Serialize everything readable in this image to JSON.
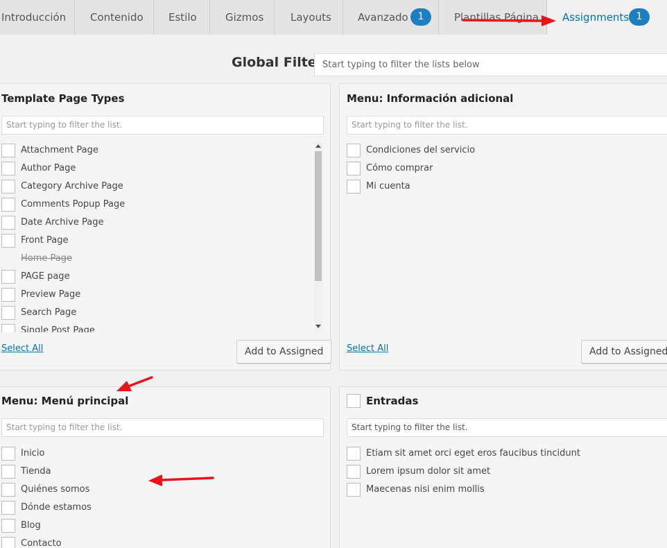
{
  "tabs": [
    {
      "label": "Introducción"
    },
    {
      "label": "Contenido"
    },
    {
      "label": "Estilo"
    },
    {
      "label": "Gizmos"
    },
    {
      "label": "Layouts"
    },
    {
      "label": "Avanzado",
      "badge": "1"
    },
    {
      "label": "Plantillas Página"
    },
    {
      "label": "Assignments",
      "badge": "1",
      "active": true
    }
  ],
  "global_filter": {
    "label": "Global Filter",
    "placeholder": "Start typing to filter the lists below"
  },
  "panels": {
    "template_types": {
      "title": "Template Page Types",
      "filter_placeholder": "Start typing to filter the list.",
      "items": [
        {
          "label": "Attachment Page"
        },
        {
          "label": "Author Page"
        },
        {
          "label": "Category Archive Page"
        },
        {
          "label": "Comments Popup Page"
        },
        {
          "label": "Date Archive Page"
        },
        {
          "label": "Front Page"
        },
        {
          "label": "Home Page",
          "disabled": true
        },
        {
          "label": "PAGE page"
        },
        {
          "label": "Preview Page"
        },
        {
          "label": "Search Page"
        },
        {
          "label": "Single Post Page"
        }
      ],
      "select_all": "Select All",
      "add_button": "Add to Assigned"
    },
    "menu_info": {
      "title": "Menu: Información adicional",
      "filter_placeholder": "Start typing to filter the list.",
      "items": [
        {
          "label": "Condiciones del servicio"
        },
        {
          "label": "Cómo comprar"
        },
        {
          "label": "Mi cuenta"
        }
      ],
      "select_all": "Select All",
      "add_button": "Add to Assigned"
    },
    "menu_principal": {
      "title": "Menu: Menú principal",
      "filter_placeholder": "Start typing to filter the list.",
      "items": [
        {
          "label": "Inicio"
        },
        {
          "label": "Tienda"
        },
        {
          "label": "Quiénes somos"
        },
        {
          "label": "Dónde estamos"
        },
        {
          "label": "Blog"
        },
        {
          "label": "Contacto"
        }
      ]
    },
    "entradas": {
      "title": "Entradas",
      "filter_placeholder": "Start typing to filter the list.",
      "items": [
        {
          "label": "Etiam sit amet orci eget eros faucibus tincidunt"
        },
        {
          "label": "Lorem ipsum dolor sit amet"
        },
        {
          "label": "Maecenas nisi enim mollis"
        }
      ]
    }
  },
  "colors": {
    "accent": "#0073aa",
    "badge": "#1e7fc0",
    "annotation_arrow": "#e8141a"
  }
}
